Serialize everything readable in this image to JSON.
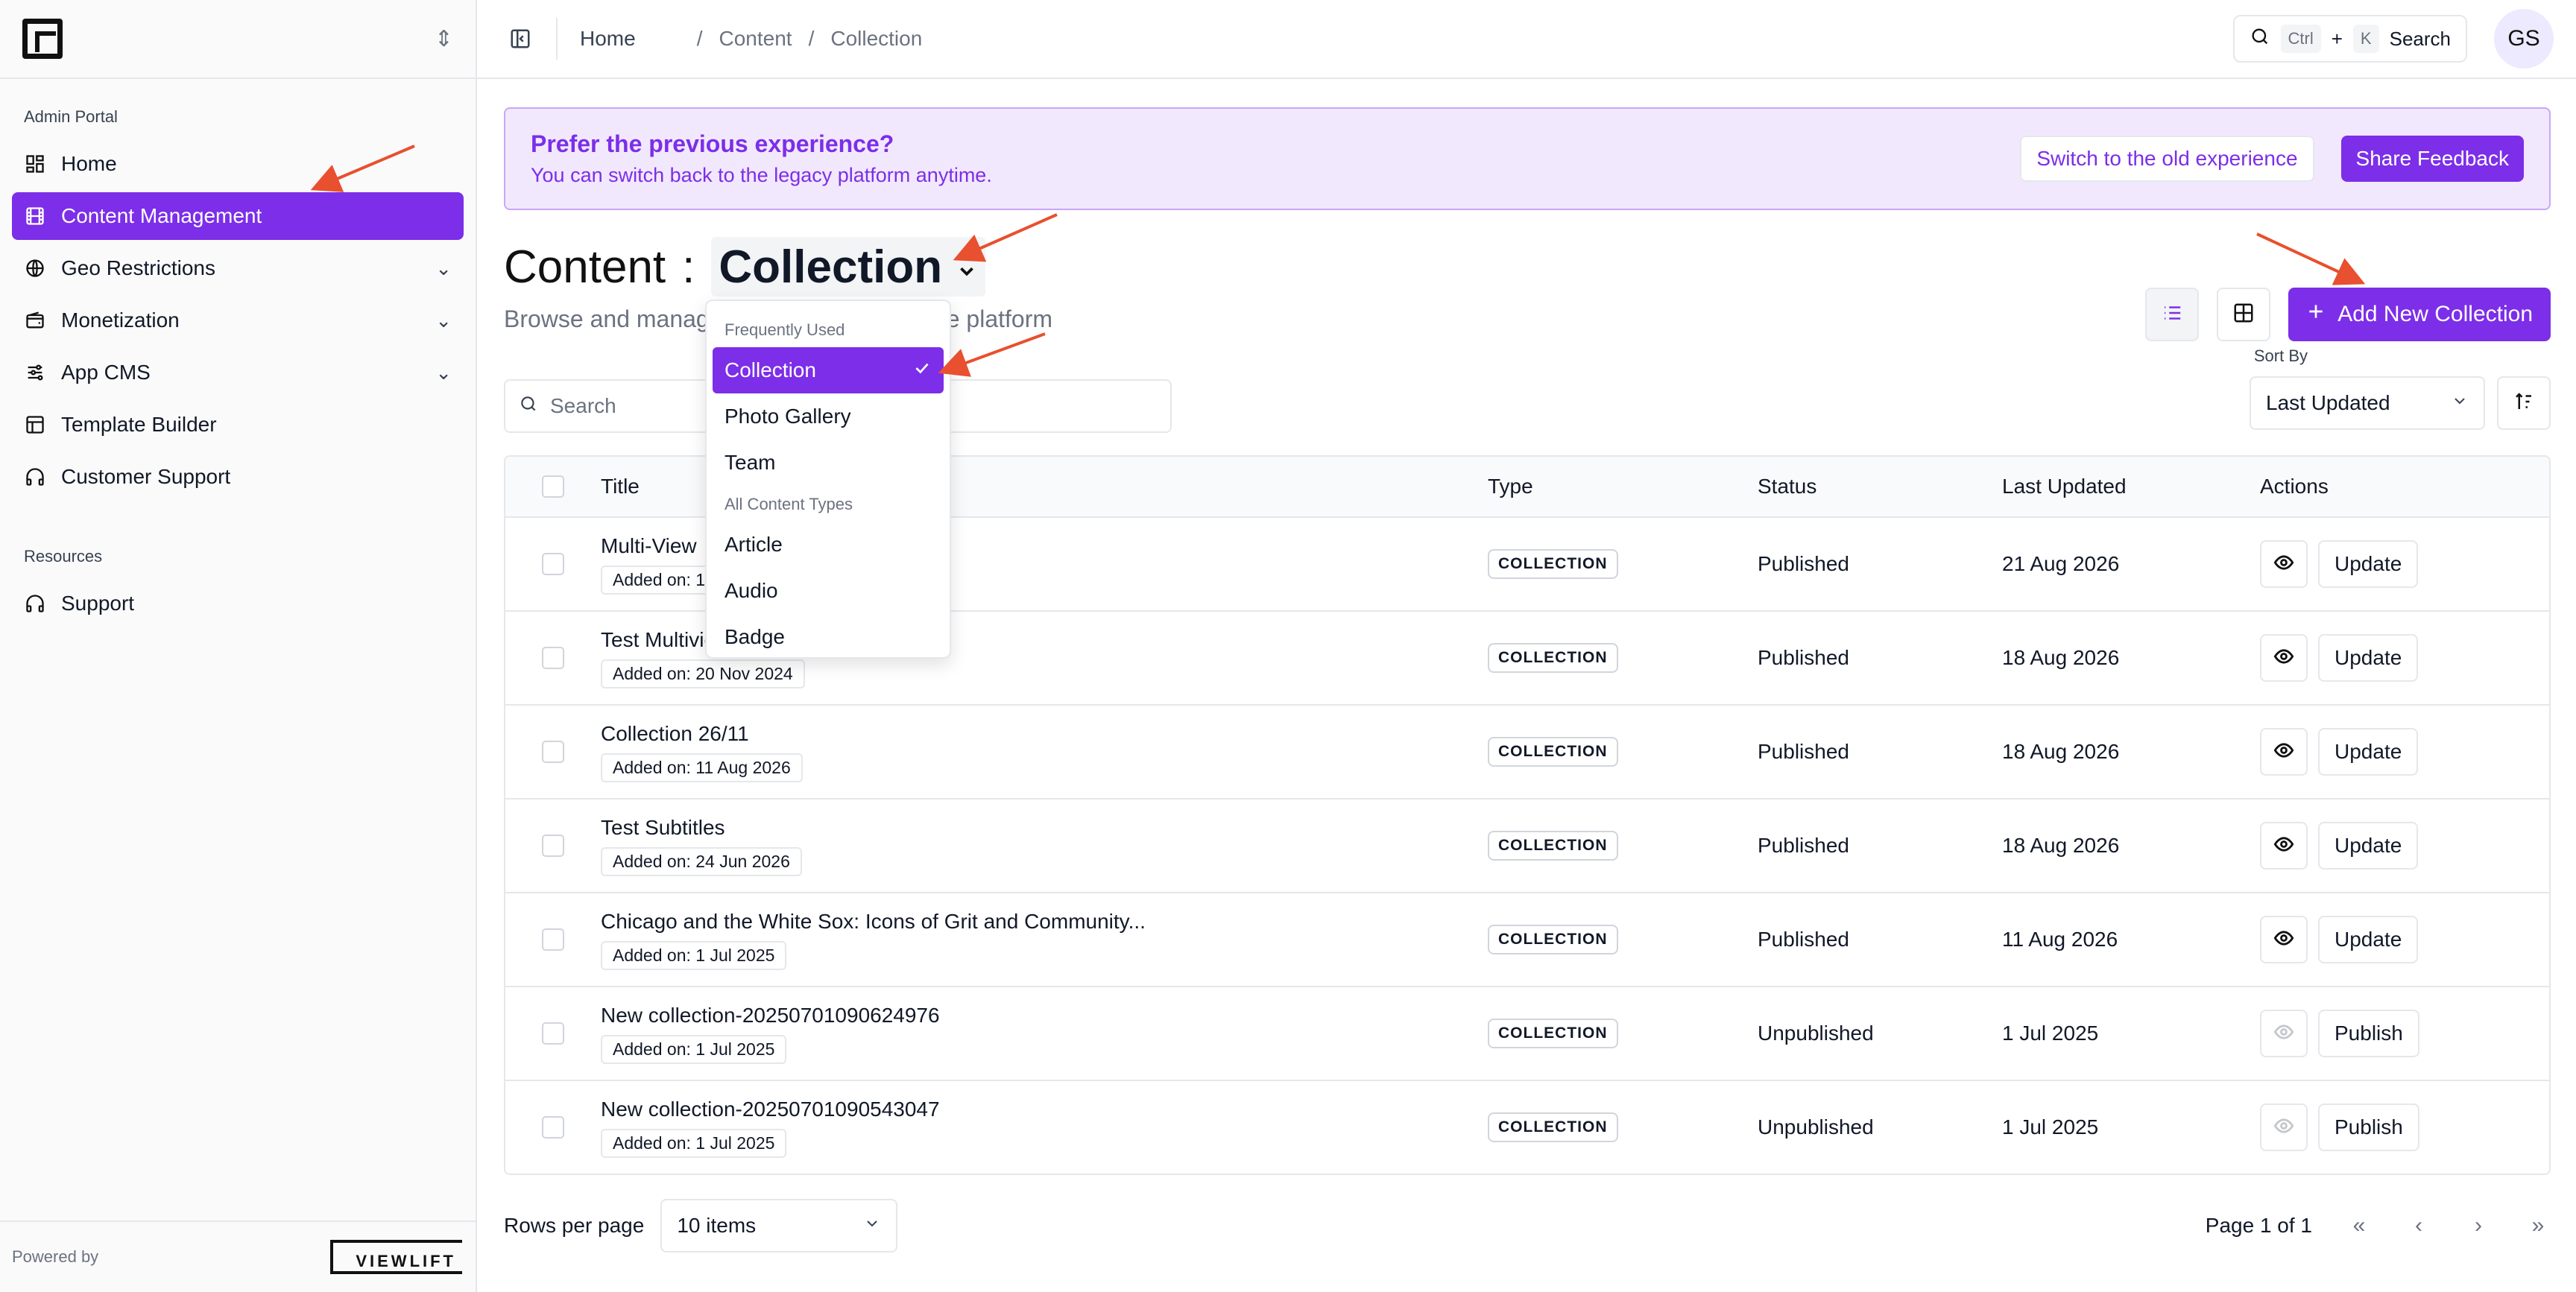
{
  "sidebar": {
    "section_admin": "Admin Portal",
    "items": [
      {
        "label": "Home"
      },
      {
        "label": "Content Management"
      },
      {
        "label": "Geo Restrictions"
      },
      {
        "label": "Monetization"
      },
      {
        "label": "App CMS"
      },
      {
        "label": "Template Builder"
      },
      {
        "label": "Customer Support"
      }
    ],
    "section_resources": "Resources",
    "resources": [
      {
        "label": "Support"
      }
    ],
    "powered_by": "Powered by",
    "brand_logo": "VIEWLIFT"
  },
  "header": {
    "breadcrumbs": [
      "Home",
      "/",
      "Content",
      "/",
      "Collection"
    ],
    "search_shortcut_1": "Ctrl",
    "search_plus": "+",
    "search_shortcut_2": "K",
    "search_label": "Search",
    "avatar_initials": "GS"
  },
  "banner": {
    "title": "Prefer the previous experience?",
    "subtitle": "You can switch back to the legacy platform anytime.",
    "switch_label": "Switch to the old experience",
    "feedback_label": "Share Feedback"
  },
  "page": {
    "title": "Content",
    "title_sep": ":",
    "content_type": "Collection",
    "subtitle_start": "Browse and manag",
    "subtitle_end": "e platform",
    "add_button": "Add New Collection",
    "search_placeholder": "Search",
    "sort_label": "Sort By",
    "sort_value": "Last Updated"
  },
  "dropdown": {
    "group_frequent": "Frequently Used",
    "frequent": [
      "Collection",
      "Photo Gallery",
      "Team"
    ],
    "group_all": "All Content Types",
    "all": [
      "Article",
      "Audio",
      "Badge"
    ]
  },
  "table": {
    "headers": {
      "title": "Title",
      "type": "Type",
      "status": "Status",
      "updated": "Last Updated",
      "actions": "Actions"
    },
    "rows": [
      {
        "title": "Multi-View",
        "added": "Added on: 1",
        "type": "COLLECTION",
        "status": "Published",
        "updated": "21 Aug 2026",
        "action": "Update"
      },
      {
        "title": "Test Multivie",
        "added": "Added on: 20 Nov 2024",
        "type": "COLLECTION",
        "status": "Published",
        "updated": "18 Aug 2026",
        "action": "Update"
      },
      {
        "title": "Collection 26/11",
        "added": "Added on: 11 Aug 2026",
        "type": "COLLECTION",
        "status": "Published",
        "updated": "18 Aug 2026",
        "action": "Update"
      },
      {
        "title": "Test Subtitles",
        "added": "Added on: 24 Jun 2026",
        "type": "COLLECTION",
        "status": "Published",
        "updated": "18 Aug 2026",
        "action": "Update"
      },
      {
        "title": "Chicago and the White Sox: Icons of Grit and Community...",
        "added": "Added on: 1 Jul 2025",
        "type": "COLLECTION",
        "status": "Published",
        "updated": "11 Aug 2026",
        "action": "Update"
      },
      {
        "title": "New collection-20250701090624976",
        "added": "Added on: 1 Jul 2025",
        "type": "COLLECTION",
        "status": "Unpublished",
        "updated": "1 Jul 2025",
        "action": "Publish"
      },
      {
        "title": "New collection-20250701090543047",
        "added": "Added on: 1 Jul 2025",
        "type": "COLLECTION",
        "status": "Unpublished",
        "updated": "1 Jul 2025",
        "action": "Publish"
      }
    ]
  },
  "footer": {
    "rows_label": "Rows per page",
    "rows_value": "10 items",
    "page_info": "Page 1 of 1",
    "first_icon": "«",
    "prev_icon": "‹",
    "next_icon": "›",
    "last_icon": "»"
  },
  "colors": {
    "accent": "#7c2ee8",
    "banner_bg": "#f1e8fe",
    "annotation_arrow": "#e8502f"
  }
}
